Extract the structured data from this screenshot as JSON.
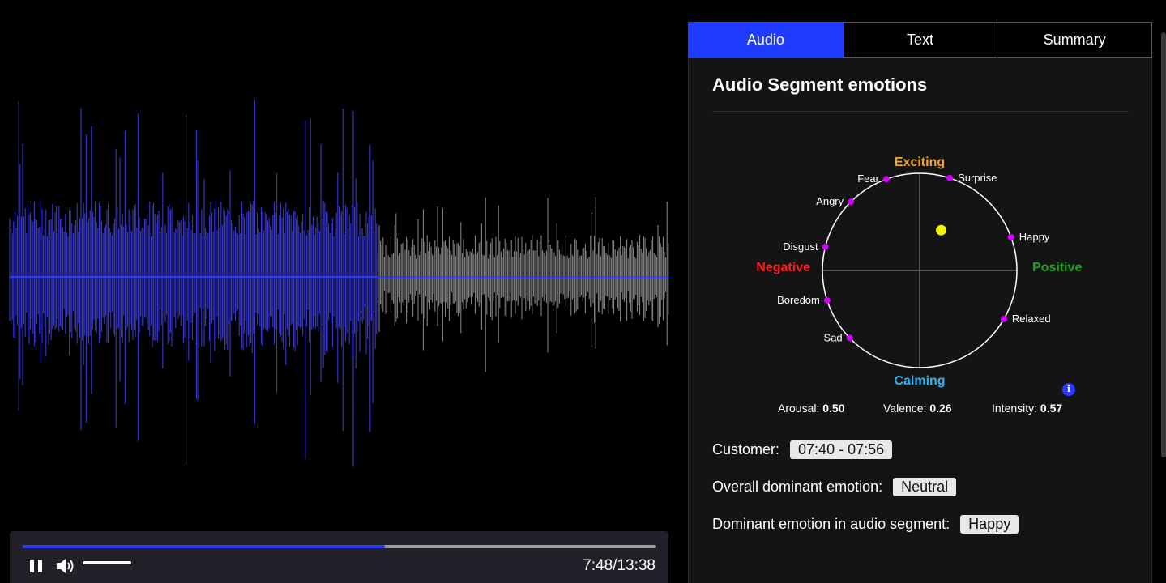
{
  "player": {
    "current_time": "7:48",
    "total_time": "13:38",
    "time_label": "7:48/13:38",
    "progress_fraction": 0.572,
    "volume_fraction": 1.0,
    "played_color": "#3b3bdc",
    "unplayed_color": "#8c8c8c"
  },
  "tabs": [
    {
      "label": "Audio",
      "active": true
    },
    {
      "label": "Text",
      "active": false
    },
    {
      "label": "Summary",
      "active": false
    }
  ],
  "panel": {
    "title": "Audio Segment emotions",
    "axes": {
      "top": "Exciting",
      "bottom": "Calming",
      "left": "Negative",
      "right": "Positive",
      "top_color": "#f5a623",
      "bottom_color": "#29b6f6",
      "left_color": "#ff1e1e",
      "right_color": "#1fa21f"
    },
    "emotion_points": [
      {
        "label": "Fear",
        "angle_deg": 110
      },
      {
        "label": "Surprise",
        "angle_deg": 72
      },
      {
        "label": "Angry",
        "angle_deg": 135
      },
      {
        "label": "Happy",
        "angle_deg": 20
      },
      {
        "label": "Disgust",
        "angle_deg": 166
      },
      {
        "label": "Boredom",
        "angle_deg": 198
      },
      {
        "label": "Sad",
        "angle_deg": 224
      },
      {
        "label": "Relaxed",
        "angle_deg": 330
      }
    ],
    "current_point": {
      "valence": 0.26,
      "arousal": 0.5
    },
    "stats": {
      "arousal_label": "Arousal:",
      "arousal_value": "0.50",
      "valence_label": "Valence:",
      "valence_value": "0.26",
      "intensity_label": "Intensity:",
      "intensity_value": "0.57"
    },
    "customer_label": "Customer:",
    "customer_time": "07:40 - 07:56",
    "overall_label": "Overall dominant emotion:",
    "overall_value": "Neutral",
    "segment_label": "Dominant emotion in audio segment:",
    "segment_value": "Happy"
  }
}
